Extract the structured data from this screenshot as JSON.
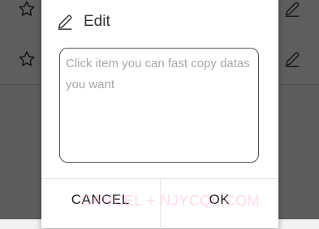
{
  "dialog": {
    "title": "Edit",
    "placeholder": "Click item you can fast copy datas you want",
    "value": "",
    "cancel_label": "CANCEL",
    "ok_label": "OK"
  },
  "watermark": "CANCEL + NJYCQL.COM",
  "icons": {
    "title": "pencil-icon",
    "row_left": "star-outline-icon",
    "row_right": "pencil-icon"
  },
  "colors": {
    "overlay": "#000000",
    "dialog_bg": "#ffffff",
    "border": "#555555",
    "placeholder": "#a8a8a8"
  }
}
